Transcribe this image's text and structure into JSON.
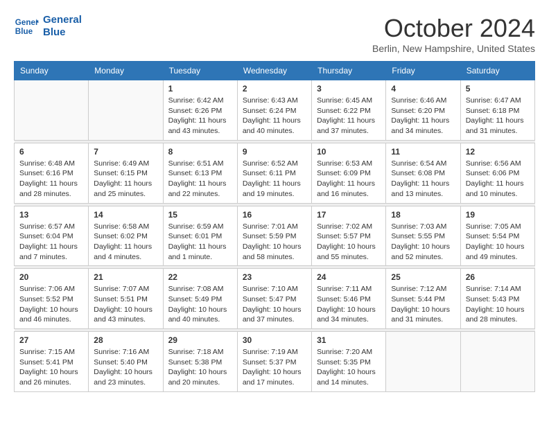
{
  "header": {
    "logo_line1": "General",
    "logo_line2": "Blue",
    "month": "October 2024",
    "location": "Berlin, New Hampshire, United States"
  },
  "weekdays": [
    "Sunday",
    "Monday",
    "Tuesday",
    "Wednesday",
    "Thursday",
    "Friday",
    "Saturday"
  ],
  "weeks": [
    [
      {
        "day": "",
        "info": ""
      },
      {
        "day": "",
        "info": ""
      },
      {
        "day": "1",
        "info": "Sunrise: 6:42 AM\nSunset: 6:26 PM\nDaylight: 11 hours and 43 minutes."
      },
      {
        "day": "2",
        "info": "Sunrise: 6:43 AM\nSunset: 6:24 PM\nDaylight: 11 hours and 40 minutes."
      },
      {
        "day": "3",
        "info": "Sunrise: 6:45 AM\nSunset: 6:22 PM\nDaylight: 11 hours and 37 minutes."
      },
      {
        "day": "4",
        "info": "Sunrise: 6:46 AM\nSunset: 6:20 PM\nDaylight: 11 hours and 34 minutes."
      },
      {
        "day": "5",
        "info": "Sunrise: 6:47 AM\nSunset: 6:18 PM\nDaylight: 11 hours and 31 minutes."
      }
    ],
    [
      {
        "day": "6",
        "info": "Sunrise: 6:48 AM\nSunset: 6:16 PM\nDaylight: 11 hours and 28 minutes."
      },
      {
        "day": "7",
        "info": "Sunrise: 6:49 AM\nSunset: 6:15 PM\nDaylight: 11 hours and 25 minutes."
      },
      {
        "day": "8",
        "info": "Sunrise: 6:51 AM\nSunset: 6:13 PM\nDaylight: 11 hours and 22 minutes."
      },
      {
        "day": "9",
        "info": "Sunrise: 6:52 AM\nSunset: 6:11 PM\nDaylight: 11 hours and 19 minutes."
      },
      {
        "day": "10",
        "info": "Sunrise: 6:53 AM\nSunset: 6:09 PM\nDaylight: 11 hours and 16 minutes."
      },
      {
        "day": "11",
        "info": "Sunrise: 6:54 AM\nSunset: 6:08 PM\nDaylight: 11 hours and 13 minutes."
      },
      {
        "day": "12",
        "info": "Sunrise: 6:56 AM\nSunset: 6:06 PM\nDaylight: 11 hours and 10 minutes."
      }
    ],
    [
      {
        "day": "13",
        "info": "Sunrise: 6:57 AM\nSunset: 6:04 PM\nDaylight: 11 hours and 7 minutes."
      },
      {
        "day": "14",
        "info": "Sunrise: 6:58 AM\nSunset: 6:02 PM\nDaylight: 11 hours and 4 minutes."
      },
      {
        "day": "15",
        "info": "Sunrise: 6:59 AM\nSunset: 6:01 PM\nDaylight: 11 hours and 1 minute."
      },
      {
        "day": "16",
        "info": "Sunrise: 7:01 AM\nSunset: 5:59 PM\nDaylight: 10 hours and 58 minutes."
      },
      {
        "day": "17",
        "info": "Sunrise: 7:02 AM\nSunset: 5:57 PM\nDaylight: 10 hours and 55 minutes."
      },
      {
        "day": "18",
        "info": "Sunrise: 7:03 AM\nSunset: 5:55 PM\nDaylight: 10 hours and 52 minutes."
      },
      {
        "day": "19",
        "info": "Sunrise: 7:05 AM\nSunset: 5:54 PM\nDaylight: 10 hours and 49 minutes."
      }
    ],
    [
      {
        "day": "20",
        "info": "Sunrise: 7:06 AM\nSunset: 5:52 PM\nDaylight: 10 hours and 46 minutes."
      },
      {
        "day": "21",
        "info": "Sunrise: 7:07 AM\nSunset: 5:51 PM\nDaylight: 10 hours and 43 minutes."
      },
      {
        "day": "22",
        "info": "Sunrise: 7:08 AM\nSunset: 5:49 PM\nDaylight: 10 hours and 40 minutes."
      },
      {
        "day": "23",
        "info": "Sunrise: 7:10 AM\nSunset: 5:47 PM\nDaylight: 10 hours and 37 minutes."
      },
      {
        "day": "24",
        "info": "Sunrise: 7:11 AM\nSunset: 5:46 PM\nDaylight: 10 hours and 34 minutes."
      },
      {
        "day": "25",
        "info": "Sunrise: 7:12 AM\nSunset: 5:44 PM\nDaylight: 10 hours and 31 minutes."
      },
      {
        "day": "26",
        "info": "Sunrise: 7:14 AM\nSunset: 5:43 PM\nDaylight: 10 hours and 28 minutes."
      }
    ],
    [
      {
        "day": "27",
        "info": "Sunrise: 7:15 AM\nSunset: 5:41 PM\nDaylight: 10 hours and 26 minutes."
      },
      {
        "day": "28",
        "info": "Sunrise: 7:16 AM\nSunset: 5:40 PM\nDaylight: 10 hours and 23 minutes."
      },
      {
        "day": "29",
        "info": "Sunrise: 7:18 AM\nSunset: 5:38 PM\nDaylight: 10 hours and 20 minutes."
      },
      {
        "day": "30",
        "info": "Sunrise: 7:19 AM\nSunset: 5:37 PM\nDaylight: 10 hours and 17 minutes."
      },
      {
        "day": "31",
        "info": "Sunrise: 7:20 AM\nSunset: 5:35 PM\nDaylight: 10 hours and 14 minutes."
      },
      {
        "day": "",
        "info": ""
      },
      {
        "day": "",
        "info": ""
      }
    ]
  ]
}
